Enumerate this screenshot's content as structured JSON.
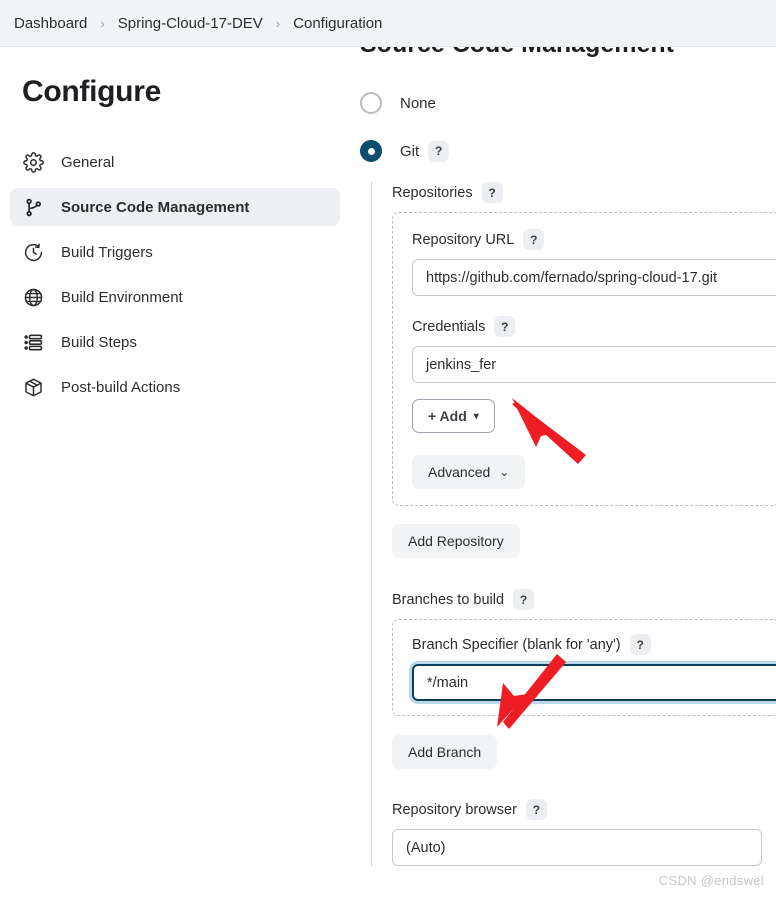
{
  "breadcrumb": {
    "separator": "›",
    "items": [
      {
        "label": "Dashboard"
      },
      {
        "label": "Spring-Cloud-17-DEV"
      },
      {
        "label": "Configuration"
      }
    ]
  },
  "sidebar": {
    "title": "Configure",
    "items": [
      {
        "label": "General",
        "icon": "gear-icon",
        "active": false
      },
      {
        "label": "Source Code Management",
        "icon": "git-branch-icon",
        "active": true
      },
      {
        "label": "Build Triggers",
        "icon": "clock-icon",
        "active": false
      },
      {
        "label": "Build Environment",
        "icon": "globe-icon",
        "active": false
      },
      {
        "label": "Build Steps",
        "icon": "list-icon",
        "active": false
      },
      {
        "label": "Post-build Actions",
        "icon": "package-icon",
        "active": false
      }
    ]
  },
  "main": {
    "section_title": "Source Code Management",
    "help_glyph": "?",
    "scm_options": [
      {
        "label": "None",
        "selected": false
      },
      {
        "label": "Git",
        "selected": true,
        "has_help": true
      }
    ],
    "repositories": {
      "label": "Repositories",
      "repository_url": {
        "label": "Repository URL",
        "value": "https://github.com/fernado/spring-cloud-17.git"
      },
      "credentials": {
        "label": "Credentials",
        "value": "jenkins_fer"
      },
      "add_button": {
        "label": "+ Add",
        "caret": "▾"
      },
      "advanced_button": {
        "label": "Advanced",
        "caret": "⌄"
      }
    },
    "add_repository_button": {
      "label": "Add Repository"
    },
    "branches": {
      "label": "Branches to build",
      "branch_specifier": {
        "label": "Branch Specifier (blank for 'any')",
        "value": "*/main",
        "focused": true
      }
    },
    "add_branch_button": {
      "label": "Add Branch"
    },
    "repository_browser": {
      "label": "Repository browser",
      "value": "(Auto)"
    }
  },
  "watermark": {
    "text": "CSDN @endswel"
  },
  "colors": {
    "accent": "#0b4d6e",
    "focus_border": "#0b3f5c",
    "focus_glow": "#bcd9ec",
    "bar_bg": "#f2f3f5",
    "active_nav_bg": "#edeff2",
    "arrow": "#ee1c23"
  }
}
